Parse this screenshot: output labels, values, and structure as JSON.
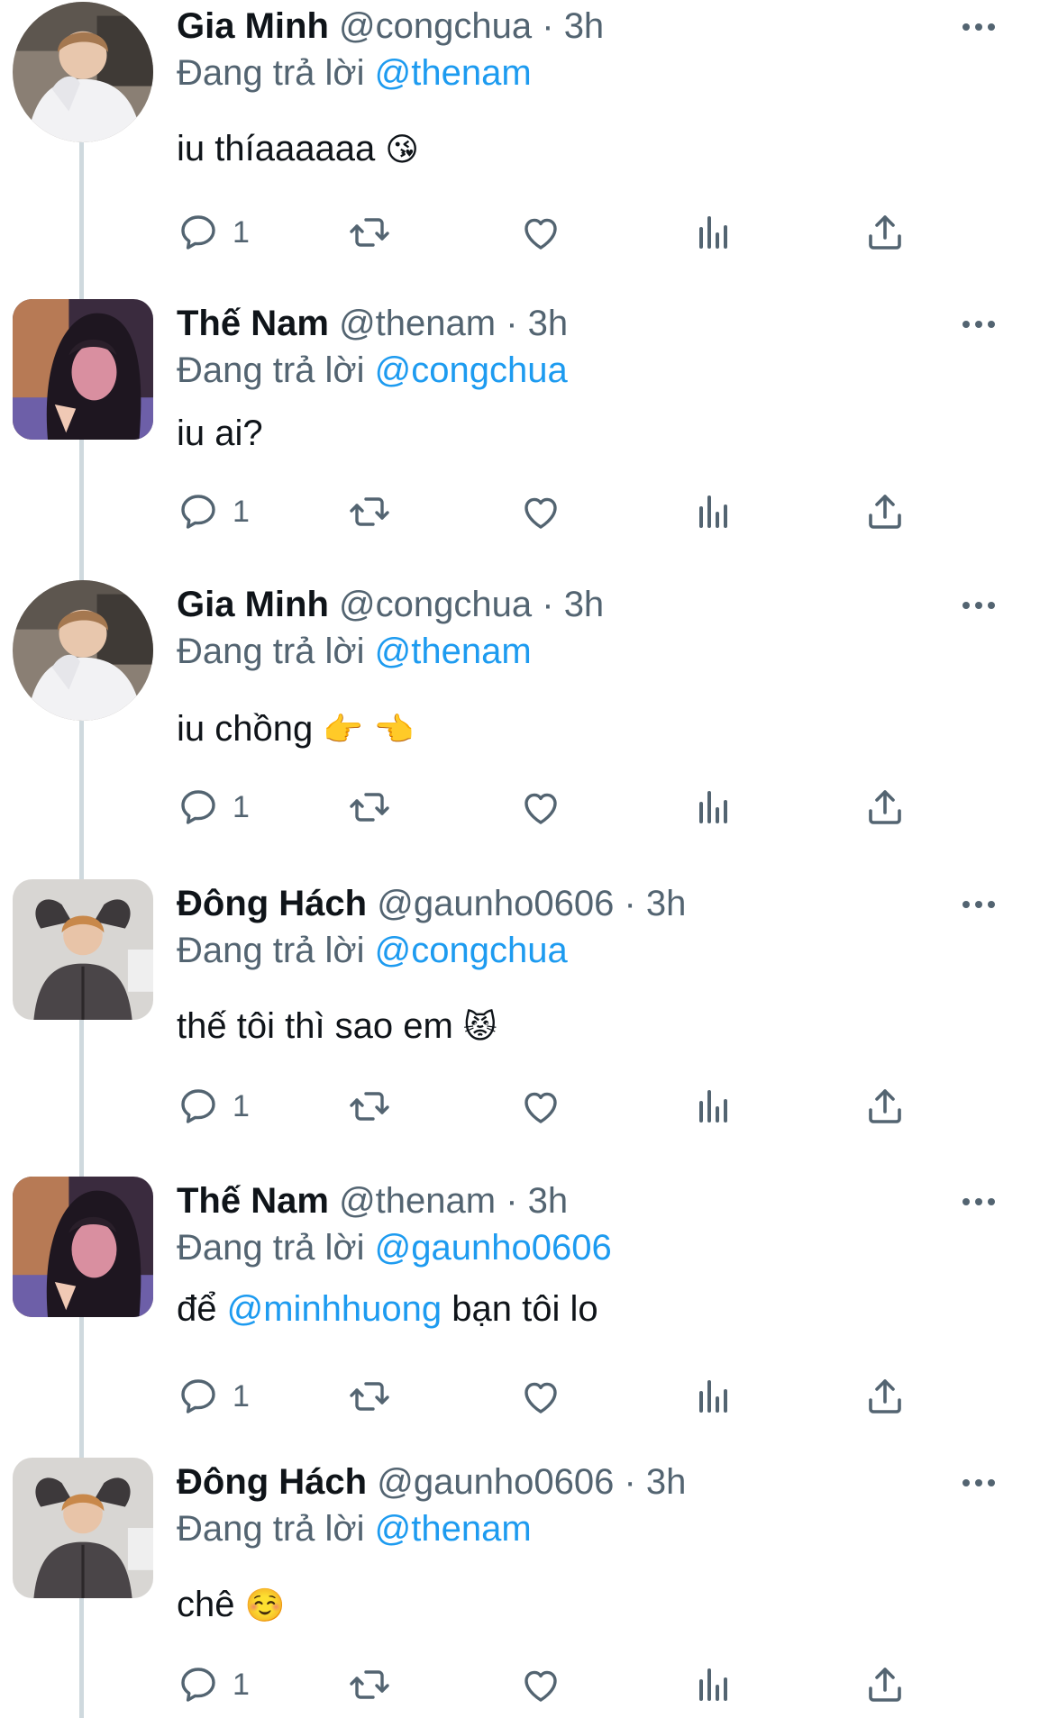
{
  "colors": {
    "accent": "#1d9bf0",
    "secondary_text": "#536471",
    "primary_text": "#0f1419",
    "thread_line": "#cfd9de"
  },
  "tweets": [
    {
      "name": "Gia Minh",
      "handle": "@congchua",
      "time": "3h",
      "replying_label": "Đang trả lời",
      "reply_to": "@thenam",
      "text": "iu thíaaaaaa",
      "emoji": "😘",
      "reply_count": "1",
      "avatar": "gia-minh-avatar"
    },
    {
      "name": "Thế Nam",
      "handle": "@thenam",
      "time": "3h",
      "replying_label": "Đang trả lời",
      "reply_to": "@congchua",
      "text": "iu ai?",
      "emoji": "",
      "reply_count": "1",
      "avatar": "the-nam-avatar"
    },
    {
      "name": "Gia Minh",
      "handle": "@congchua",
      "time": "3h",
      "replying_label": "Đang trả lời",
      "reply_to": "@thenam",
      "text": "iu chồng",
      "emoji": "👉 👈",
      "reply_count": "1",
      "avatar": "gia-minh-avatar"
    },
    {
      "name": "Đông Hách",
      "handle": "@gaunho0606",
      "time": "3h",
      "replying_label": "Đang trả lời",
      "reply_to": "@congchua",
      "text": "thế tôi thì sao em",
      "emoji": "😾",
      "reply_count": "1",
      "avatar": "dong-hach-avatar"
    },
    {
      "name": "Thế Nam",
      "handle": "@thenam",
      "time": "3h",
      "replying_label": "Đang trả lời",
      "reply_to": "@gaunho0606",
      "text_before": "để",
      "text_mention": "@minhhuong",
      "text_after": "bạn tôi lo",
      "reply_count": "1",
      "avatar": "the-nam-avatar"
    },
    {
      "name": "Đông Hách",
      "handle": "@gaunho0606",
      "time": "3h",
      "replying_label": "Đang trả lời",
      "reply_to": "@thenam",
      "text": "chê",
      "emoji": "☺️",
      "reply_count": "1",
      "avatar": "dong-hach-avatar"
    }
  ]
}
